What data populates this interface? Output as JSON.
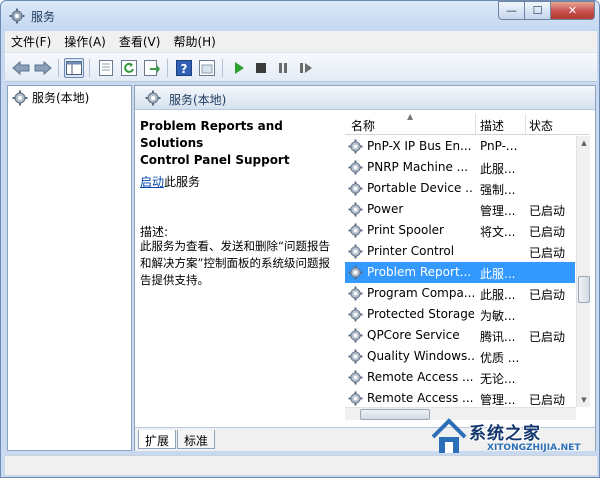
{
  "window": {
    "title": "服务",
    "min_glyph": "—",
    "max_glyph": "☐",
    "close_glyph": "✕"
  },
  "menu": [
    "文件(F)",
    "操作(A)",
    "查看(V)",
    "帮助(H)"
  ],
  "left_pane": {
    "tree_root": "服务(本地)"
  },
  "right_pane": {
    "header": "服务(本地)",
    "detail": {
      "service_name_line1": "Problem Reports and Solutions",
      "service_name_line2": "Control Panel Support",
      "start_link": "启动",
      "start_suffix": "此服务",
      "description_label": "描述:",
      "description_text": "此服务为查看、发送和删除“问题报告和解决方案”控制面板的系统级问题报告提供支持。"
    },
    "columns": [
      "名称",
      "描述",
      "状态"
    ],
    "services": [
      {
        "name": "PnP-X IP Bus En...",
        "desc": "PnP-...",
        "status": ""
      },
      {
        "name": "PNRP Machine ...",
        "desc": "此服...",
        "status": ""
      },
      {
        "name": "Portable Device ...",
        "desc": "强制...",
        "status": ""
      },
      {
        "name": "Power",
        "desc": "管理...",
        "status": "已启动"
      },
      {
        "name": "Print Spooler",
        "desc": "将文...",
        "status": "已启动"
      },
      {
        "name": "Printer Control",
        "desc": "",
        "status": "已启动"
      },
      {
        "name": "Problem Report...",
        "desc": "此服...",
        "status": "",
        "selected": true
      },
      {
        "name": "Program Compa...",
        "desc": "此服...",
        "status": "已启动"
      },
      {
        "name": "Protected Storage",
        "desc": "为敏...",
        "status": ""
      },
      {
        "name": "QPCore Service",
        "desc": "腾讯...",
        "status": "已启动"
      },
      {
        "name": "Quality Windows...",
        "desc": "优质 ...",
        "status": ""
      },
      {
        "name": "Remote Access ...",
        "desc": "无论...",
        "status": ""
      },
      {
        "name": "Remote Access ...",
        "desc": "管理...",
        "status": "已启动"
      }
    ],
    "tabs": [
      "扩展",
      "标准"
    ]
  },
  "watermark": {
    "text": "系统之家",
    "url": "XITONGZHIJIA.NET"
  },
  "colors": {
    "selection": "#3399ff",
    "frame": "#c9daf0",
    "link": "#0645ad"
  }
}
